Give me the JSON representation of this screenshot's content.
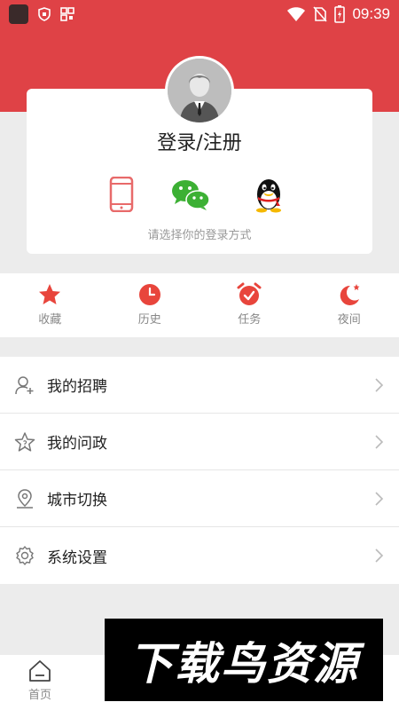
{
  "status_bar": {
    "time": "09:39"
  },
  "login": {
    "title": "登录/注册",
    "hint": "请选择你的登录方式",
    "methods": [
      {
        "icon": "phone-icon"
      },
      {
        "icon": "wechat-icon"
      },
      {
        "icon": "qq-icon"
      }
    ]
  },
  "quick_actions": [
    {
      "label": "收藏",
      "icon": "star-icon"
    },
    {
      "label": "历史",
      "icon": "clock-icon"
    },
    {
      "label": "任务",
      "icon": "alarm-check-icon"
    },
    {
      "label": "夜间",
      "icon": "moon-icon"
    }
  ],
  "menu": [
    {
      "label": "我的招聘",
      "icon": "user-add-icon"
    },
    {
      "label": "我的问政",
      "icon": "star-question-icon"
    },
    {
      "label": "城市切换",
      "icon": "location-icon"
    },
    {
      "label": "系统设置",
      "icon": "settings-icon"
    }
  ],
  "bottom_nav": {
    "home_label": "首页"
  },
  "watermark": {
    "text": "下载鸟资源"
  },
  "colors": {
    "accent": "#df4246",
    "background": "#ececec"
  }
}
